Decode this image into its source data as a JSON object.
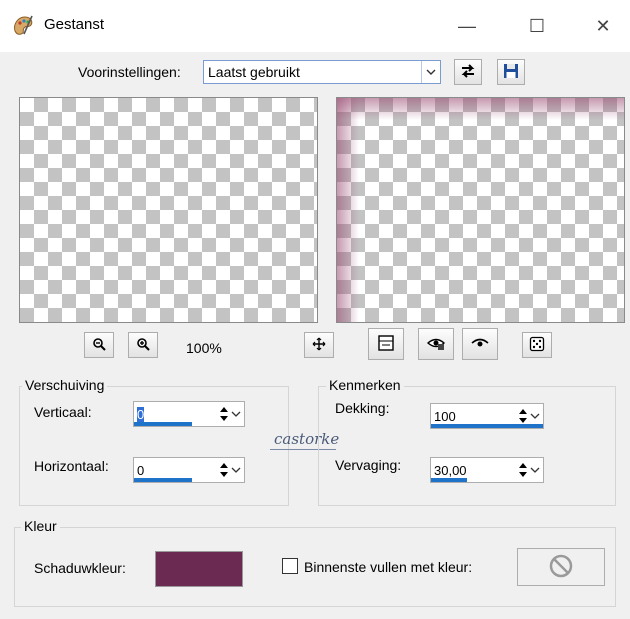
{
  "window": {
    "title": "Gestanst",
    "minimize_glyph": "—",
    "maximize_glyph": "☐",
    "close_glyph": "✕"
  },
  "presets": {
    "label": "Voorinstellingen:",
    "selected": "Laatst gebruikt"
  },
  "preview": {
    "zoom": "100%"
  },
  "offset": {
    "group_label": "Verschuiving",
    "vertical_label": "Verticaal:",
    "vertical_value": "0",
    "horizontal_label": "Horizontaal:",
    "horizontal_value": "0"
  },
  "properties": {
    "group_label": "Kenmerken",
    "opacity_label": "Dekking:",
    "opacity_value": "100",
    "blur_label": "Vervaging:",
    "blur_value": "30,00"
  },
  "color": {
    "group_label": "Kleur",
    "shadow_label": "Schaduwkleur:",
    "shadow_color": "#6b2a52",
    "fill_inside_label": "Binnenste vullen met kleur:",
    "fill_inside_checked": false
  },
  "watermark": {
    "text": "castorke"
  }
}
